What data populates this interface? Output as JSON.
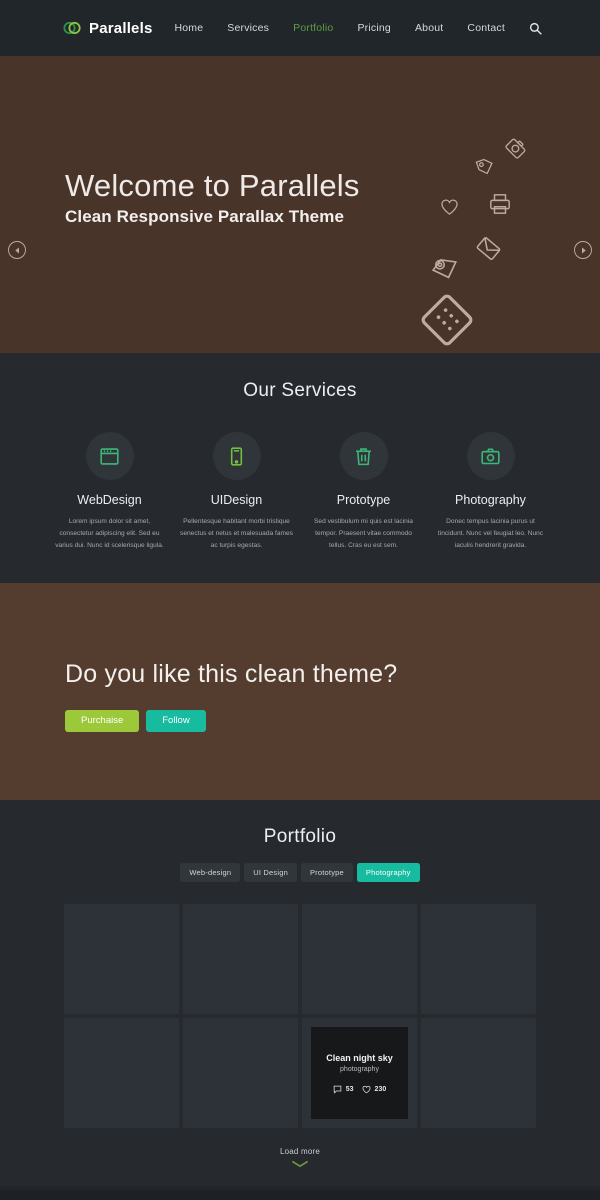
{
  "header": {
    "logo_text": "Parallels",
    "logo_icon": "parallels-rings-icon",
    "nav": [
      {
        "label": "Home",
        "active": false
      },
      {
        "label": "Services",
        "active": false
      },
      {
        "label": "Portfolio",
        "active": true
      },
      {
        "label": "Pricing",
        "active": false
      },
      {
        "label": "About",
        "active": false
      },
      {
        "label": "Contact",
        "active": false
      }
    ],
    "search_icon": "search-icon"
  },
  "hero": {
    "title": "Welcome to Parallels",
    "subtitle": "Clean Responsive Parallax Theme",
    "prev_icon": "arrow-left-circle-icon",
    "next_icon": "arrow-right-circle-icon",
    "decor_icons": [
      "camera-icon",
      "tag-icon",
      "heart-icon",
      "printer-icon",
      "envelope-icon",
      "location-pin-photo-icon",
      "grid-diamond-icon",
      "sun-icon"
    ],
    "bg_color": "#493429"
  },
  "services": {
    "title": "Our Services",
    "items": [
      {
        "icon": "browser-window-icon",
        "name": "WebDesign",
        "desc": "Lorem ipsum dolor sit amet, consectetur adipiscing elit. Sed eu varius dui. Nunc id scelerisque ligula."
      },
      {
        "icon": "mobile-phone-icon",
        "name": "UIDesign",
        "desc": "Pellentesque habitant morbi tristique senectus et netus et malesuada fames ac turpis egestas."
      },
      {
        "icon": "trash-bin-icon",
        "name": "Prototype",
        "desc": "Sed vestibulum mi quis est lacinia tempor. Praesent vitae commodo tellus. Cras eu est sem."
      },
      {
        "icon": "camera-icon",
        "name": "Photography",
        "desc": "Donec tempus lacinia purus ut tincidunt. Nunc vel feugiat leo. Nunc iaculis hendrerit gravida."
      }
    ]
  },
  "cta": {
    "title": "Do you like this clean theme?",
    "purchase_label": "Purchaise",
    "follow_label": "Follow",
    "purchase_color": "#9bc93a",
    "follow_color": "#17bba0",
    "bg_color": "#543c2e"
  },
  "portfolio": {
    "title": "Portfolio",
    "filters": [
      {
        "label": "Web-design",
        "active": false
      },
      {
        "label": "UI Design",
        "active": false
      },
      {
        "label": "Prototype",
        "active": false
      },
      {
        "label": "Photography",
        "active": true
      }
    ],
    "featured": {
      "index": 6,
      "title": "Clean night sky",
      "category": "photography",
      "comments": "53",
      "likes": "230",
      "comment_icon": "comment-icon",
      "like_icon": "heart-icon"
    },
    "tile_count": 8,
    "load_more_label": "Load more",
    "load_more_icon": "chevron-down-icon",
    "accent_color": "#17bba0"
  }
}
